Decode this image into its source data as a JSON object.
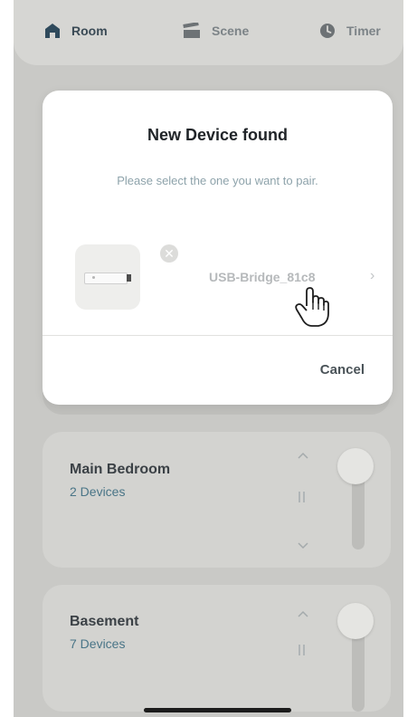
{
  "tabs": {
    "room": {
      "label": "Room",
      "icon": "house-icon",
      "active": true
    },
    "scene": {
      "label": "Scene",
      "icon": "scene-clapper-icon"
    },
    "timer": {
      "label": "Timer",
      "icon": "clock-icon"
    }
  },
  "modal": {
    "title": "New Device found",
    "subtitle": "Please select the one you want to pair.",
    "device": {
      "name": "USB-Bridge_81c8",
      "icon": "usb-stick-icon",
      "remove_icon": "close-circle-icon",
      "chevron_icon": "chevron-right-icon"
    },
    "cancel_label": "Cancel"
  },
  "rooms": [
    {
      "name": "Main Bedroom",
      "devices": "2 Devices"
    },
    {
      "name": "Basement",
      "devices": "7 Devices"
    }
  ],
  "colors": {
    "dim_background": "#c9c9c6",
    "modal_background": "#ffffff",
    "tab_active": "#3a4a55",
    "device_count": "#4a7587",
    "subtitle": "#8ea3ab"
  }
}
